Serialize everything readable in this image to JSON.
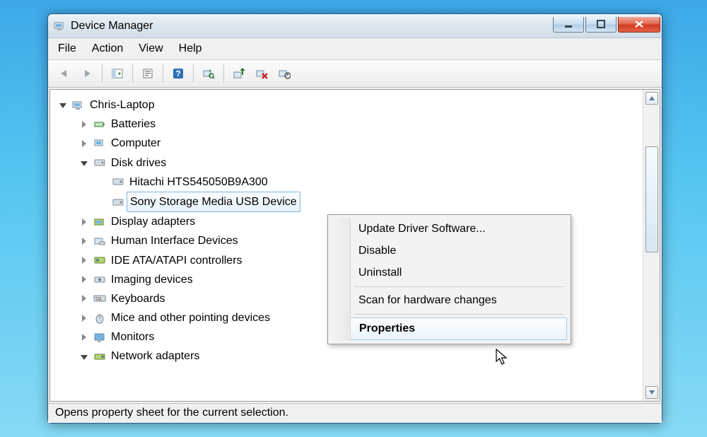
{
  "window": {
    "title": "Device Manager"
  },
  "menu": {
    "file": "File",
    "action": "Action",
    "view": "View",
    "help": "Help"
  },
  "tree": {
    "root": "Chris-Laptop",
    "batteries": "Batteries",
    "computer": "Computer",
    "disk_drives": "Disk drives",
    "disk1": "Hitachi HTS545050B9A300",
    "disk2": "Sony Storage Media USB Device",
    "display_adapters": "Display adapters",
    "hid": "Human Interface Devices",
    "ide": "IDE ATA/ATAPI controllers",
    "imaging": "Imaging devices",
    "keyboards": "Keyboards",
    "mice": "Mice and other pointing devices",
    "monitors": "Monitors",
    "network": "Network adapters"
  },
  "context_menu": {
    "update": "Update Driver Software...",
    "disable": "Disable",
    "uninstall": "Uninstall",
    "scan": "Scan for hardware changes",
    "properties": "Properties"
  },
  "status": "Opens property sheet for the current selection."
}
